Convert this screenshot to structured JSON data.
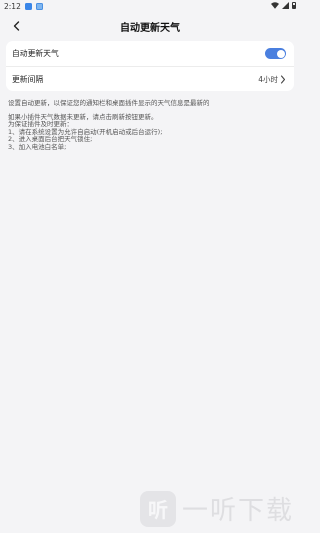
{
  "status_bar": {
    "time": "2:12",
    "icons": [
      "app-icon-blue",
      "app-icon-image",
      "wifi-icon",
      "signal-icon",
      "battery-icon"
    ]
  },
  "nav": {
    "title": "自动更新天气",
    "back_icon": "chevron-left-icon"
  },
  "settings": {
    "auto_update": {
      "label": "自动更新天气",
      "enabled": true
    },
    "interval": {
      "label": "更新间隔",
      "value": "4小时",
      "icon": "chevron-right-icon"
    }
  },
  "description": "设置自动更新，以保证您的通知栏和桌面插件显示的天气信息是最新的",
  "help": {
    "lines": [
      "如果小插件天气数据未更新，请点击刷新按钮更新。",
      "为保证插件及时更新：",
      "1、请在系统设置为允许自启动(开机启动或后台运行);",
      "2、进入桌面后台把天气锁住;",
      "3、加入电池白名单;"
    ]
  },
  "watermark": {
    "text": "一听下载",
    "logo_char": "听"
  },
  "colors": {
    "accent": "#4a7fdf",
    "background": "#f4f4f6",
    "card": "#ffffff"
  }
}
